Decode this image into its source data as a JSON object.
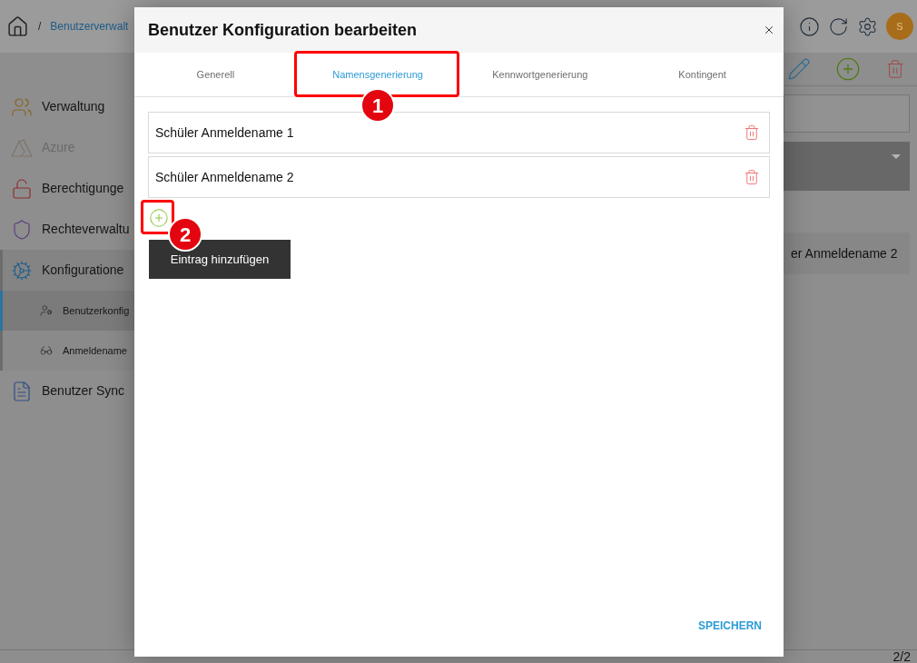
{
  "header": {
    "breadcrumb": {
      "separator": "/",
      "items": [
        "Benutzerverwalt"
      ]
    },
    "avatar": {
      "initial": "S"
    }
  },
  "sidebar": {
    "items": [
      {
        "label": "Verwaltung",
        "disabled": false,
        "expanded": false
      },
      {
        "label": "Azure",
        "disabled": true,
        "expanded": false
      },
      {
        "label": "Berechtigunge",
        "disabled": false,
        "expanded": false
      },
      {
        "label": "Rechteverwaltu",
        "disabled": false,
        "expanded": false
      },
      {
        "label": "Konfiguratione",
        "disabled": false,
        "expanded": true,
        "children": [
          {
            "label": "Benutzerkonfig",
            "selected": true
          },
          {
            "label": "Anmeldename",
            "selected": false
          }
        ]
      },
      {
        "label": "Benutzer Sync",
        "disabled": false,
        "expanded": false
      }
    ]
  },
  "main": {
    "list_item": {
      "label": "er Anmeldename 2"
    },
    "pagination": "2/2"
  },
  "dialog": {
    "title": "Benutzer Konfiguration bearbeiten",
    "tabs": [
      {
        "label": "Generell",
        "selected": false
      },
      {
        "label": "Namensgenerierung",
        "selected": true
      },
      {
        "label": "Kennwortgenerierung",
        "selected": false
      },
      {
        "label": "Kontingent",
        "selected": false
      }
    ],
    "entries": [
      {
        "label": "Schüler Anmeldename 1"
      },
      {
        "label": "Schüler Anmeldename 2"
      }
    ],
    "tooltip": "Eintrag hinzufügen",
    "save_label": "SPEICHERN"
  },
  "annotations": [
    {
      "label": "1"
    },
    {
      "label": "2"
    }
  ]
}
